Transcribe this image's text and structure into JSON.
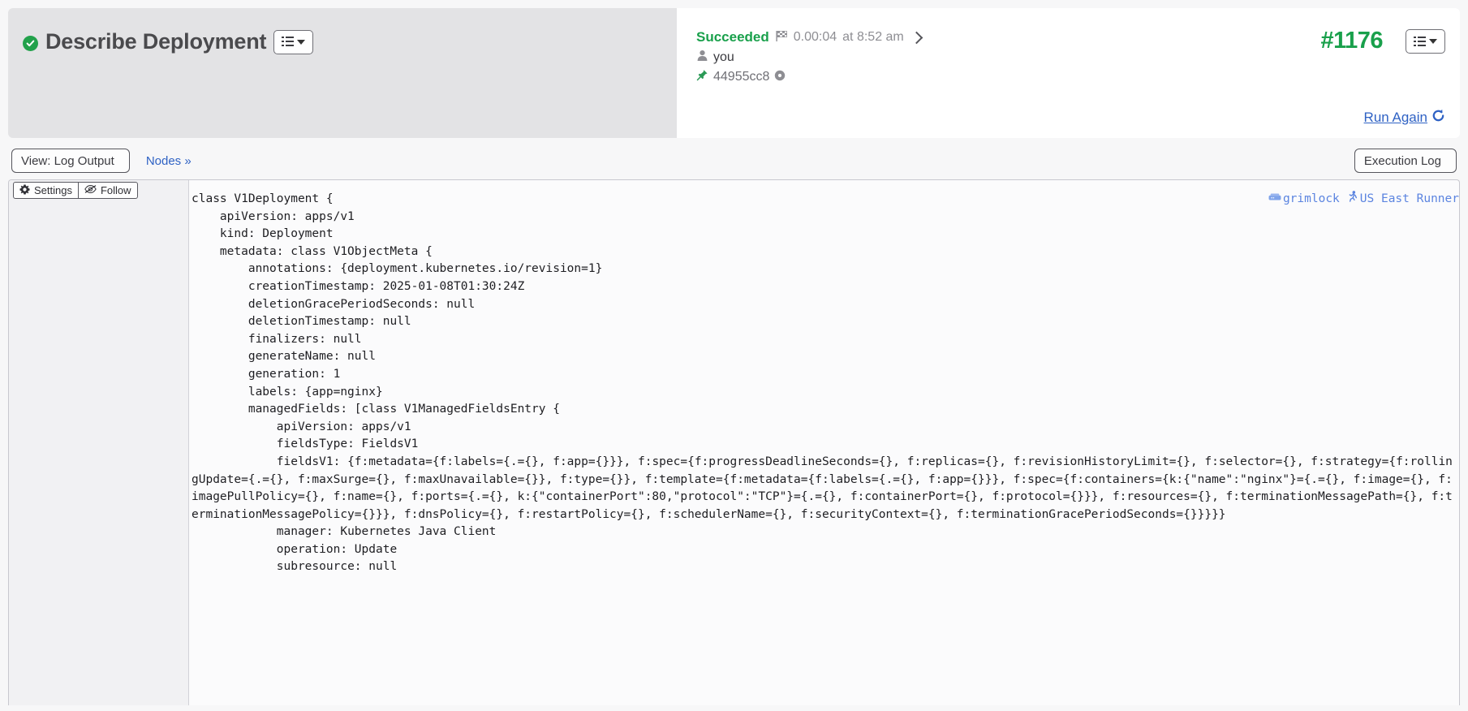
{
  "header": {
    "title": "Describe Deployment",
    "status_icon": "check-circle-icon",
    "menu_icon": "list-menu-icon"
  },
  "status": {
    "result": "Succeeded",
    "duration_icon": "checkered-flag-icon",
    "duration": "0.00:04",
    "time": "at 8:52 am",
    "expand_icon": "chevron-right-icon",
    "user_icon": "user-icon",
    "user": "you",
    "commit_icon": "pin-icon",
    "commit": "44955cc8",
    "commit_badge_icon": "circle-dot-icon"
  },
  "build": {
    "number": "#1176",
    "menu_icon": "list-menu-icon",
    "run_again_label": "Run Again",
    "run_again_icon": "refresh-icon"
  },
  "toolbar": {
    "view_label": "View: Log Output",
    "nodes_label": "Nodes »",
    "execution_log_label": "Execution Log"
  },
  "log_controls": {
    "settings_label": "Settings",
    "settings_icon": "gear-icon",
    "follow_label": "Follow",
    "follow_icon": "eye-slash-icon"
  },
  "runner": {
    "machine_icon": "server-icon",
    "machine": "grimlock",
    "agent_icon": "runner-icon",
    "agent": "US East Runner"
  },
  "colors": {
    "success_green": "#19a04b",
    "link_blue": "#2f62c4",
    "runner_blue": "#5b84e0",
    "panel_grey": "#e3e3e5"
  },
  "log": {
    "text": "class V1Deployment {\n    apiVersion: apps/v1\n    kind: Deployment\n    metadata: class V1ObjectMeta {\n        annotations: {deployment.kubernetes.io/revision=1}\n        creationTimestamp: 2025-01-08T01:30:24Z\n        deletionGracePeriodSeconds: null\n        deletionTimestamp: null\n        finalizers: null\n        generateName: null\n        generation: 1\n        labels: {app=nginx}\n        managedFields: [class V1ManagedFieldsEntry {\n            apiVersion: apps/v1\n            fieldsType: FieldsV1\n            fieldsV1: {f:metadata={f:labels={.={}, f:app={}}}, f:spec={f:progressDeadlineSeconds={}, f:replicas={}, f:revisionHistoryLimit={}, f:selector={}, f:strategy={f:rollingUpdate={.={}, f:maxSurge={}, f:maxUnavailable={}}, f:type={}}, f:template={f:metadata={f:labels={.={}, f:app={}}}, f:spec={f:containers={k:{\"name\":\"nginx\"}={.={}, f:image={}, f:imagePullPolicy={}, f:name={}, f:ports={.={}, k:{\"containerPort\":80,\"protocol\":\"TCP\"}={.={}, f:containerPort={}, f:protocol={}}}, f:resources={}, f:terminationMessagePath={}, f:terminationMessagePolicy={}}}, f:dnsPolicy={}, f:restartPolicy={}, f:schedulerName={}, f:securityContext={}, f:terminationGracePeriodSeconds={}}}}}\n            manager: Kubernetes Java Client\n            operation: Update\n            subresource: null"
  }
}
